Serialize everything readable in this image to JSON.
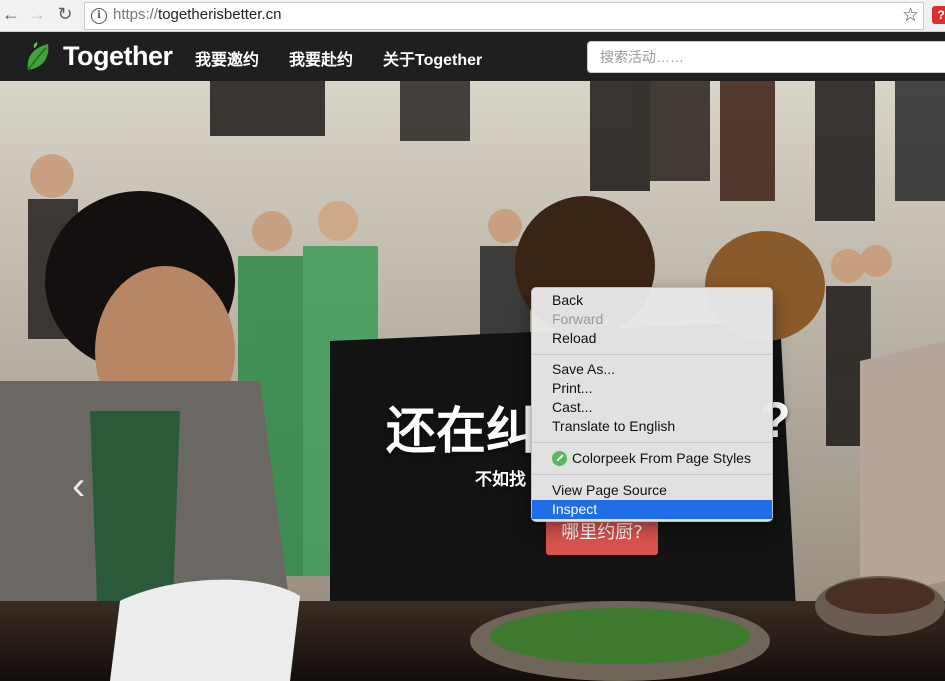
{
  "browser": {
    "back_icon": "←",
    "forward_icon": "→",
    "reload_icon": "↻",
    "url_scheme": "https://",
    "url_host": "togetherisbetter.cn",
    "info_icon": "i",
    "star_icon": "☆",
    "extension_icon": "?"
  },
  "header": {
    "brand": "Together",
    "nav": [
      "我要邀约",
      "我要赴约",
      "关于Together"
    ],
    "search_placeholder": "搜索活动……"
  },
  "hero": {
    "headline_start": "还在纠",
    "headline_end": "?",
    "subline": "不如找",
    "cta": "哪里约厨?",
    "prev_icon": "‹"
  },
  "context_menu": {
    "back": "Back",
    "forward": "Forward",
    "reload": "Reload",
    "save_as": "Save As...",
    "print": "Print...",
    "cast": "Cast...",
    "translate": "Translate to English",
    "colorpeek": "Colorpeek From Page Styles",
    "view_source": "View Page Source",
    "inspect": "Inspect"
  },
  "colors": {
    "nav_bg": "#1f1f1f",
    "accent_green": "#5cb85c",
    "cta_red": "#d9534f",
    "menu_highlight": "#1f6ee8"
  }
}
